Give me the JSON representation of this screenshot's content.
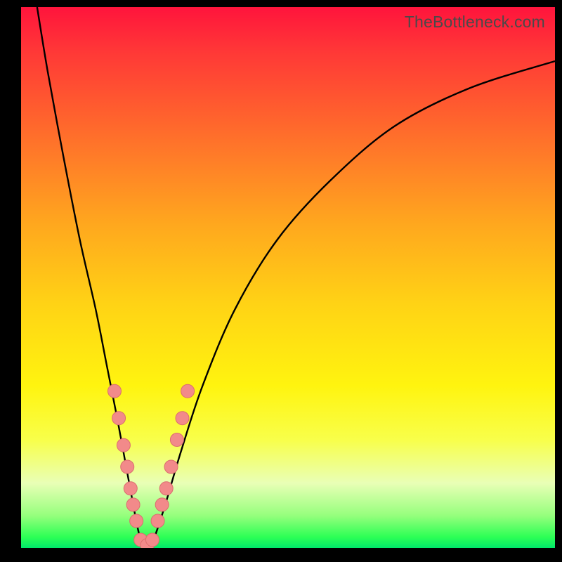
{
  "watermark": {
    "text": "TheBottleneck.com"
  },
  "chart_data": {
    "type": "line",
    "title": "",
    "xlabel": "",
    "ylabel": "",
    "xlim": [
      0,
      100
    ],
    "ylim": [
      0,
      100
    ],
    "curve": {
      "name": "bottleneck-curve",
      "x": [
        3,
        5,
        8,
        11,
        14,
        16,
        18,
        19.5,
        21,
        22,
        23,
        24,
        25,
        27,
        30,
        34,
        40,
        48,
        58,
        70,
        84,
        100
      ],
      "y": [
        100,
        88,
        72,
        57,
        44,
        34,
        24,
        16,
        8,
        3,
        0,
        0,
        2,
        8,
        18,
        30,
        44,
        57,
        68,
        78,
        85,
        90
      ]
    },
    "markers": {
      "name": "scatter-points",
      "color": "#f28a8a",
      "stroke": "#db6e6e",
      "x": [
        17.5,
        18.3,
        19.2,
        19.9,
        20.5,
        21.0,
        21.6,
        22.4,
        23.6,
        24.6,
        25.6,
        26.4,
        27.2,
        28.1,
        29.2,
        30.2,
        31.2
      ],
      "y": [
        29,
        24,
        19,
        15,
        11,
        8,
        5,
        1.5,
        0.5,
        1.5,
        5,
        8,
        11,
        15,
        20,
        24,
        29
      ]
    },
    "gradient_stops": [
      {
        "pos": 0,
        "color": "#ff143c"
      },
      {
        "pos": 18,
        "color": "#ff5a2f"
      },
      {
        "pos": 40,
        "color": "#ffa71e"
      },
      {
        "pos": 70,
        "color": "#fff40f"
      },
      {
        "pos": 94,
        "color": "#96ff7d"
      },
      {
        "pos": 100,
        "color": "#00e86a"
      }
    ]
  }
}
